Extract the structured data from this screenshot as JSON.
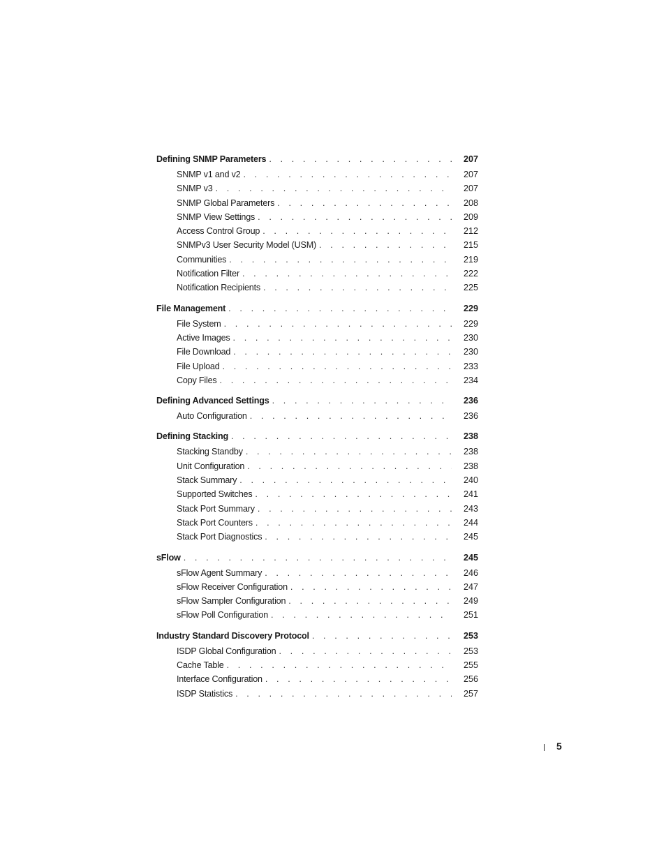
{
  "toc": [
    {
      "title": "Defining SNMP Parameters",
      "page": "207",
      "items": [
        {
          "title": "SNMP v1 and v2",
          "page": "207"
        },
        {
          "title": "SNMP v3",
          "page": "207"
        },
        {
          "title": "SNMP Global Parameters",
          "page": "208"
        },
        {
          "title": "SNMP View Settings",
          "page": "209"
        },
        {
          "title": "Access Control Group",
          "page": "212"
        },
        {
          "title": "SNMPv3 User Security Model (USM)",
          "page": "215"
        },
        {
          "title": "Communities",
          "page": "219"
        },
        {
          "title": "Notification Filter",
          "page": "222"
        },
        {
          "title": "Notification Recipients",
          "page": "225"
        }
      ]
    },
    {
      "title": "File Management",
      "page": "229",
      "items": [
        {
          "title": "File System",
          "page": "229"
        },
        {
          "title": "Active Images",
          "page": "230"
        },
        {
          "title": "File Download",
          "page": "230"
        },
        {
          "title": "File Upload",
          "page": "233"
        },
        {
          "title": "Copy Files",
          "page": "234"
        }
      ]
    },
    {
      "title": "Defining Advanced Settings",
      "page": "236",
      "items": [
        {
          "title": "Auto Configuration",
          "page": "236"
        }
      ]
    },
    {
      "title": "Defining Stacking",
      "page": "238",
      "items": [
        {
          "title": "Stacking Standby",
          "page": "238"
        },
        {
          "title": "Unit Configuration",
          "page": "238"
        },
        {
          "title": "Stack Summary",
          "page": "240"
        },
        {
          "title": "Supported Switches",
          "page": "241"
        },
        {
          "title": "Stack Port Summary",
          "page": "243"
        },
        {
          "title": "Stack Port Counters",
          "page": "244"
        },
        {
          "title": "Stack Port Diagnostics",
          "page": "245"
        }
      ]
    },
    {
      "title": "sFlow",
      "page": "245",
      "items": [
        {
          "title": "sFlow Agent Summary",
          "page": "246"
        },
        {
          "title": "sFlow Receiver Configuration",
          "page": "247"
        },
        {
          "title": "sFlow Sampler Configuration",
          "page": "249"
        },
        {
          "title": "sFlow Poll Configuration",
          "page": "251"
        }
      ]
    },
    {
      "title": "Industry Standard Discovery Protocol",
      "page": "253",
      "items": [
        {
          "title": "ISDP Global Configuration",
          "page": "253"
        },
        {
          "title": "Cache Table",
          "page": "255"
        },
        {
          "title": "Interface Configuration",
          "page": "256"
        },
        {
          "title": "ISDP Statistics",
          "page": "257"
        }
      ]
    }
  ],
  "footer": {
    "page_number": "5"
  }
}
